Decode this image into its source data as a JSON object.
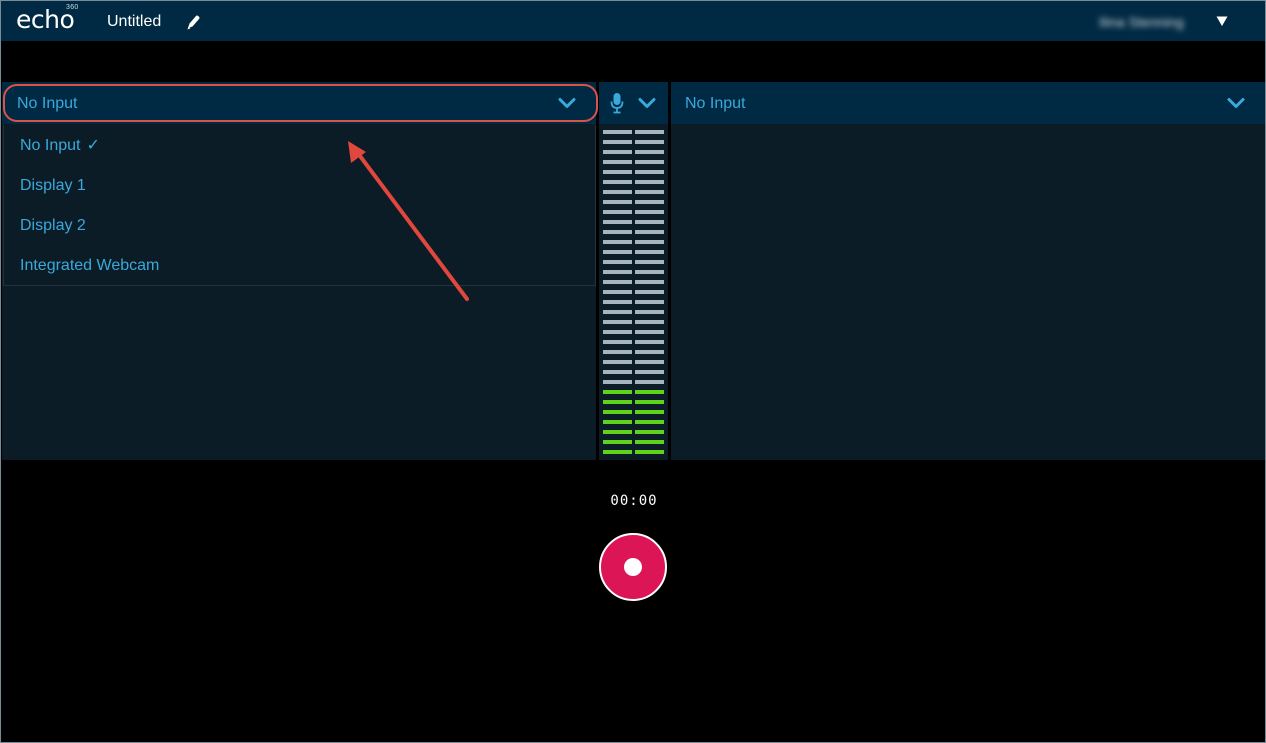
{
  "app": {
    "logo_text": "echo",
    "logo_superscript": "360",
    "recording_title": "Untitled",
    "user_name": "Ilina Stenning"
  },
  "left_source": {
    "selected": "No Input",
    "options": [
      {
        "label": "No Input",
        "checked": true
      },
      {
        "label": "Display 1",
        "checked": false
      },
      {
        "label": "Display 2",
        "checked": false
      },
      {
        "label": "Integrated Webcam",
        "checked": false
      }
    ],
    "check_glyph": "✓"
  },
  "right_source": {
    "selected": "No Input"
  },
  "audio": {
    "mic_icon": "microphone-icon",
    "level_fraction": 0.2
  },
  "timer": "00:00",
  "colors": {
    "accent": "#39a9db",
    "topbar": "#002a44",
    "record": "#dc1656",
    "meter_active": "#5fd31c",
    "meter_idle": "#a7b3bd",
    "annotation": "#d9534a"
  },
  "icons": {
    "edit": "pencil-icon",
    "user_menu": "caret-down-icon",
    "dropdown": "chevron-down-icon",
    "record": "record-icon"
  }
}
